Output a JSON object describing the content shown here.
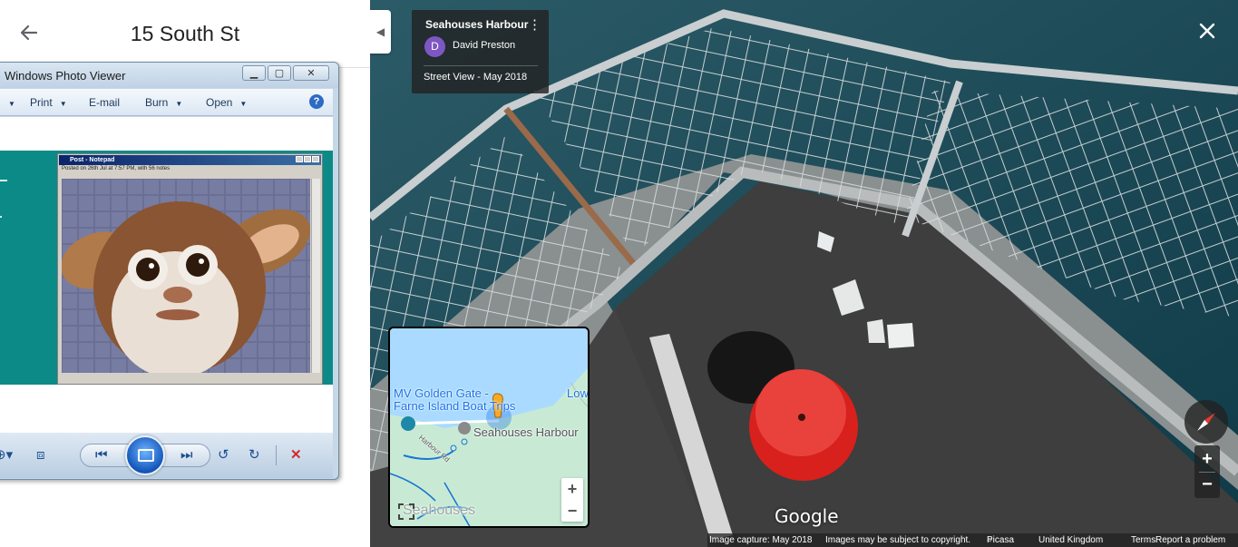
{
  "left_panel": {
    "title": "15 South St",
    "photo_viewer": {
      "window_title": "Windows Photo Viewer",
      "menu": [
        "Print",
        "E-mail",
        "Burn",
        "Open"
      ],
      "notepad_title": "Post - Notepad",
      "notepad_subtitle": "Posted on 26th Jul at 7:57 PM, with 56 notes"
    }
  },
  "street_view": {
    "place_title": "Seahouses Harbour",
    "author_initial": "D",
    "author_name": "David Preston",
    "capture_label": "Street View - May 2018",
    "google_logo": "Google",
    "footer": {
      "capture": "Image capture: May 2018",
      "copyright": "Images may be subject to copyright.",
      "picasa": "Picasa",
      "region": "United Kingdom",
      "terms": "Terms",
      "report": "Report a problem"
    },
    "minimap": {
      "label_ferry_1": "MV Golden Gate -",
      "label_ferry_2": "Farne Island Boat Trips",
      "label_harbour": "Seahouses Harbour",
      "label_low": "Low",
      "label_town": "Seahouses",
      "label_road": "Harbour Rd"
    }
  },
  "colors": {
    "avatar": "#7e57c2",
    "teal": "#0b8a87",
    "map_water": "#aadaff",
    "map_land": "#c8ead5"
  }
}
